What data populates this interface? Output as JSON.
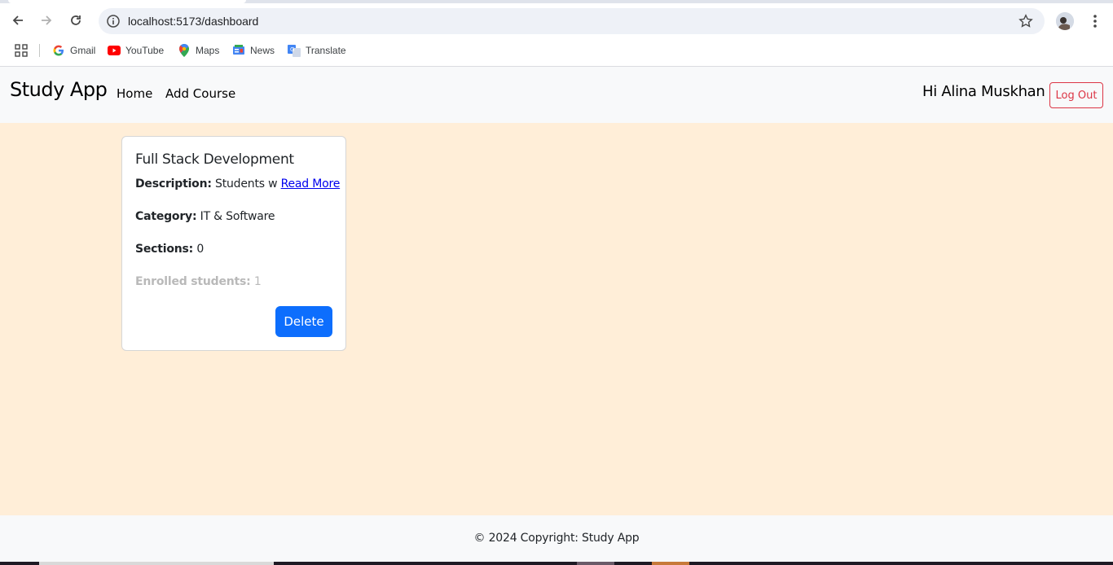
{
  "browser": {
    "url": "localhost:5173/dashboard",
    "bookmarks": [
      {
        "label": "Gmail",
        "icon": "google-icon"
      },
      {
        "label": "YouTube",
        "icon": "youtube-icon"
      },
      {
        "label": "Maps",
        "icon": "maps-icon"
      },
      {
        "label": "News",
        "icon": "news-icon"
      },
      {
        "label": "Translate",
        "icon": "translate-icon"
      }
    ]
  },
  "navbar": {
    "brand": "Study App",
    "links": [
      "Home",
      "Add Course"
    ],
    "greeting": "Hi Alina Muskhan",
    "logout_label": "Log Out"
  },
  "course": {
    "title": "Full Stack Development",
    "description_label": "Description:",
    "description_value": "Students w",
    "read_more": "Read More",
    "category_label": "Category:",
    "category_value": "IT & Software",
    "sections_label": "Sections:",
    "sections_value": "0",
    "enrolled_label": "Enrolled students:",
    "enrolled_value": "1",
    "delete_label": "Delete"
  },
  "footer": {
    "text": "© 2024 Copyright: Study App"
  },
  "colors": {
    "main_bg": "#ffeed8",
    "primary": "#0d6efd",
    "danger": "#dc3545",
    "navbar_bg": "#f8f9fa"
  }
}
